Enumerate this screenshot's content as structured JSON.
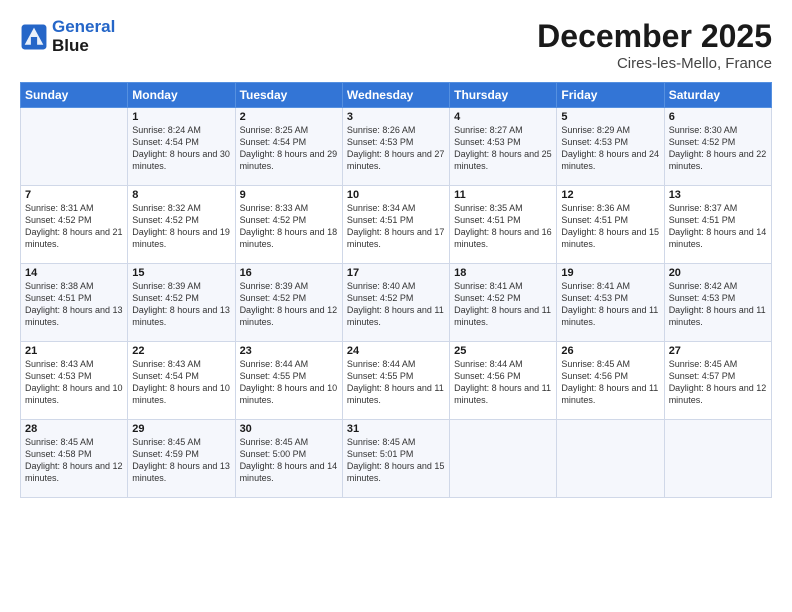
{
  "header": {
    "logo_line1": "General",
    "logo_line2": "Blue",
    "month": "December 2025",
    "location": "Cires-les-Mello, France"
  },
  "weekdays": [
    "Sunday",
    "Monday",
    "Tuesday",
    "Wednesday",
    "Thursday",
    "Friday",
    "Saturday"
  ],
  "weeks": [
    [
      {
        "day": "",
        "sunrise": "",
        "sunset": "",
        "daylight": ""
      },
      {
        "day": "1",
        "sunrise": "Sunrise: 8:24 AM",
        "sunset": "Sunset: 4:54 PM",
        "daylight": "Daylight: 8 hours and 30 minutes."
      },
      {
        "day": "2",
        "sunrise": "Sunrise: 8:25 AM",
        "sunset": "Sunset: 4:54 PM",
        "daylight": "Daylight: 8 hours and 29 minutes."
      },
      {
        "day": "3",
        "sunrise": "Sunrise: 8:26 AM",
        "sunset": "Sunset: 4:53 PM",
        "daylight": "Daylight: 8 hours and 27 minutes."
      },
      {
        "day": "4",
        "sunrise": "Sunrise: 8:27 AM",
        "sunset": "Sunset: 4:53 PM",
        "daylight": "Daylight: 8 hours and 25 minutes."
      },
      {
        "day": "5",
        "sunrise": "Sunrise: 8:29 AM",
        "sunset": "Sunset: 4:53 PM",
        "daylight": "Daylight: 8 hours and 24 minutes."
      },
      {
        "day": "6",
        "sunrise": "Sunrise: 8:30 AM",
        "sunset": "Sunset: 4:52 PM",
        "daylight": "Daylight: 8 hours and 22 minutes."
      }
    ],
    [
      {
        "day": "7",
        "sunrise": "Sunrise: 8:31 AM",
        "sunset": "Sunset: 4:52 PM",
        "daylight": "Daylight: 8 hours and 21 minutes."
      },
      {
        "day": "8",
        "sunrise": "Sunrise: 8:32 AM",
        "sunset": "Sunset: 4:52 PM",
        "daylight": "Daylight: 8 hours and 19 minutes."
      },
      {
        "day": "9",
        "sunrise": "Sunrise: 8:33 AM",
        "sunset": "Sunset: 4:52 PM",
        "daylight": "Daylight: 8 hours and 18 minutes."
      },
      {
        "day": "10",
        "sunrise": "Sunrise: 8:34 AM",
        "sunset": "Sunset: 4:51 PM",
        "daylight": "Daylight: 8 hours and 17 minutes."
      },
      {
        "day": "11",
        "sunrise": "Sunrise: 8:35 AM",
        "sunset": "Sunset: 4:51 PM",
        "daylight": "Daylight: 8 hours and 16 minutes."
      },
      {
        "day": "12",
        "sunrise": "Sunrise: 8:36 AM",
        "sunset": "Sunset: 4:51 PM",
        "daylight": "Daylight: 8 hours and 15 minutes."
      },
      {
        "day": "13",
        "sunrise": "Sunrise: 8:37 AM",
        "sunset": "Sunset: 4:51 PM",
        "daylight": "Daylight: 8 hours and 14 minutes."
      }
    ],
    [
      {
        "day": "14",
        "sunrise": "Sunrise: 8:38 AM",
        "sunset": "Sunset: 4:51 PM",
        "daylight": "Daylight: 8 hours and 13 minutes."
      },
      {
        "day": "15",
        "sunrise": "Sunrise: 8:39 AM",
        "sunset": "Sunset: 4:52 PM",
        "daylight": "Daylight: 8 hours and 13 minutes."
      },
      {
        "day": "16",
        "sunrise": "Sunrise: 8:39 AM",
        "sunset": "Sunset: 4:52 PM",
        "daylight": "Daylight: 8 hours and 12 minutes."
      },
      {
        "day": "17",
        "sunrise": "Sunrise: 8:40 AM",
        "sunset": "Sunset: 4:52 PM",
        "daylight": "Daylight: 8 hours and 11 minutes."
      },
      {
        "day": "18",
        "sunrise": "Sunrise: 8:41 AM",
        "sunset": "Sunset: 4:52 PM",
        "daylight": "Daylight: 8 hours and 11 minutes."
      },
      {
        "day": "19",
        "sunrise": "Sunrise: 8:41 AM",
        "sunset": "Sunset: 4:53 PM",
        "daylight": "Daylight: 8 hours and 11 minutes."
      },
      {
        "day": "20",
        "sunrise": "Sunrise: 8:42 AM",
        "sunset": "Sunset: 4:53 PM",
        "daylight": "Daylight: 8 hours and 11 minutes."
      }
    ],
    [
      {
        "day": "21",
        "sunrise": "Sunrise: 8:43 AM",
        "sunset": "Sunset: 4:53 PM",
        "daylight": "Daylight: 8 hours and 10 minutes."
      },
      {
        "day": "22",
        "sunrise": "Sunrise: 8:43 AM",
        "sunset": "Sunset: 4:54 PM",
        "daylight": "Daylight: 8 hours and 10 minutes."
      },
      {
        "day": "23",
        "sunrise": "Sunrise: 8:44 AM",
        "sunset": "Sunset: 4:55 PM",
        "daylight": "Daylight: 8 hours and 10 minutes."
      },
      {
        "day": "24",
        "sunrise": "Sunrise: 8:44 AM",
        "sunset": "Sunset: 4:55 PM",
        "daylight": "Daylight: 8 hours and 11 minutes."
      },
      {
        "day": "25",
        "sunrise": "Sunrise: 8:44 AM",
        "sunset": "Sunset: 4:56 PM",
        "daylight": "Daylight: 8 hours and 11 minutes."
      },
      {
        "day": "26",
        "sunrise": "Sunrise: 8:45 AM",
        "sunset": "Sunset: 4:56 PM",
        "daylight": "Daylight: 8 hours and 11 minutes."
      },
      {
        "day": "27",
        "sunrise": "Sunrise: 8:45 AM",
        "sunset": "Sunset: 4:57 PM",
        "daylight": "Daylight: 8 hours and 12 minutes."
      }
    ],
    [
      {
        "day": "28",
        "sunrise": "Sunrise: 8:45 AM",
        "sunset": "Sunset: 4:58 PM",
        "daylight": "Daylight: 8 hours and 12 minutes."
      },
      {
        "day": "29",
        "sunrise": "Sunrise: 8:45 AM",
        "sunset": "Sunset: 4:59 PM",
        "daylight": "Daylight: 8 hours and 13 minutes."
      },
      {
        "day": "30",
        "sunrise": "Sunrise: 8:45 AM",
        "sunset": "Sunset: 5:00 PM",
        "daylight": "Daylight: 8 hours and 14 minutes."
      },
      {
        "day": "31",
        "sunrise": "Sunrise: 8:45 AM",
        "sunset": "Sunset: 5:01 PM",
        "daylight": "Daylight: 8 hours and 15 minutes."
      },
      {
        "day": "",
        "sunrise": "",
        "sunset": "",
        "daylight": ""
      },
      {
        "day": "",
        "sunrise": "",
        "sunset": "",
        "daylight": ""
      },
      {
        "day": "",
        "sunrise": "",
        "sunset": "",
        "daylight": ""
      }
    ]
  ]
}
